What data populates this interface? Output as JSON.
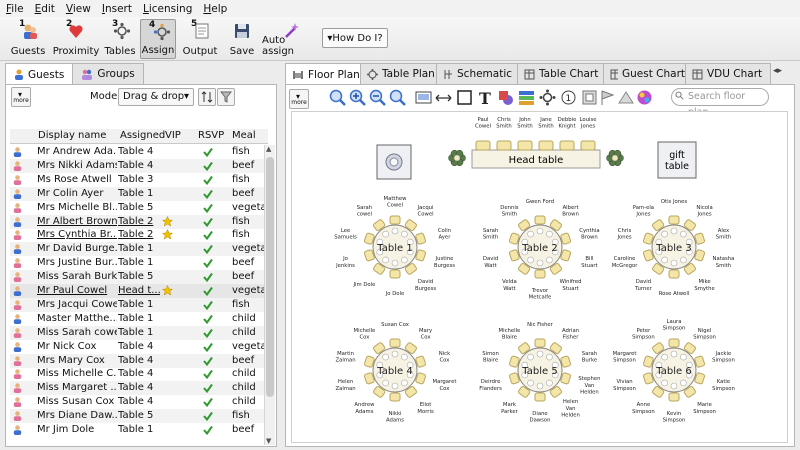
{
  "menu": [
    "File",
    "Edit",
    "View",
    "Insert",
    "Licensing",
    "Help"
  ],
  "toolbar": {
    "guests": "Guests",
    "proximity": "Proximity",
    "tables": "Tables",
    "assign": "Assign",
    "output": "Output",
    "save": "Save",
    "auto_assign": "Auto assign",
    "how_do_i": "▾How Do I?",
    "num1": "1",
    "num2": "2",
    "num3": "3",
    "num4": "4",
    "num5": "5"
  },
  "left_tabs": {
    "guests": "Guests",
    "groups": "Groups"
  },
  "more": "more",
  "mode_label": "Mode:",
  "mode_value": "Drag & drop",
  "columns": [
    "Display name",
    "Assigned",
    "VIP",
    "RSVP",
    "Meal"
  ],
  "guests": [
    {
      "name": "Mr Andrew Ada...",
      "table": "Table 4",
      "vip": false,
      "rsvp": true,
      "meal": "fish",
      "gender": "m"
    },
    {
      "name": "Mrs Nikki Adams",
      "table": "Table 4",
      "vip": false,
      "rsvp": true,
      "meal": "beef",
      "gender": "f"
    },
    {
      "name": "Ms Rose Atwell",
      "table": "Table 3",
      "vip": false,
      "rsvp": true,
      "meal": "fish",
      "gender": "f"
    },
    {
      "name": "Mr Colin Ayer",
      "table": "Table 1",
      "vip": false,
      "rsvp": true,
      "meal": "beef",
      "gender": "m"
    },
    {
      "name": "Mrs Michelle Bl...",
      "table": "Table 5",
      "vip": false,
      "rsvp": true,
      "meal": "vegetar...",
      "gender": "f"
    },
    {
      "name": "Mr Albert Brown",
      "table": "Table 2",
      "vip": true,
      "rsvp": true,
      "meal": "fish",
      "gender": "m",
      "underline": true
    },
    {
      "name": "Mrs Cynthia Br...",
      "table": "Table 2",
      "vip": true,
      "rsvp": true,
      "meal": "fish",
      "gender": "f",
      "underline": true
    },
    {
      "name": "Mr David Burge...",
      "table": "Table 1",
      "vip": false,
      "rsvp": true,
      "meal": "vegetar...",
      "gender": "m"
    },
    {
      "name": "Mrs Justine Bur...",
      "table": "Table 1",
      "vip": false,
      "rsvp": true,
      "meal": "beef",
      "gender": "f"
    },
    {
      "name": "Miss Sarah Burke",
      "table": "Table 5",
      "vip": false,
      "rsvp": true,
      "meal": "beef",
      "gender": "f"
    },
    {
      "name": "Mr Paul Cowel",
      "table": "Head t...",
      "vip": true,
      "rsvp": true,
      "meal": "vegetar...",
      "gender": "m",
      "underline": true
    },
    {
      "name": "Mrs Jacqui Cowel",
      "table": "Table 1",
      "vip": false,
      "rsvp": true,
      "meal": "fish",
      "gender": "f"
    },
    {
      "name": "Master Matthe...",
      "table": "Table 1",
      "vip": false,
      "rsvp": true,
      "meal": "child",
      "gender": "m"
    },
    {
      "name": "Miss Sarah cowel",
      "table": "Table 1",
      "vip": false,
      "rsvp": true,
      "meal": "child",
      "gender": "f"
    },
    {
      "name": "Mr Nick Cox",
      "table": "Table 4",
      "vip": false,
      "rsvp": true,
      "meal": "vegetar...",
      "gender": "m"
    },
    {
      "name": "Mrs Mary Cox",
      "table": "Table 4",
      "vip": false,
      "rsvp": true,
      "meal": "beef",
      "gender": "f"
    },
    {
      "name": "Miss Michelle C...",
      "table": "Table 4",
      "vip": false,
      "rsvp": true,
      "meal": "child",
      "gender": "f"
    },
    {
      "name": "Miss Margaret ...",
      "table": "Table 4",
      "vip": false,
      "rsvp": true,
      "meal": "child",
      "gender": "f"
    },
    {
      "name": "Miss Susan Cox",
      "table": "Table 4",
      "vip": false,
      "rsvp": true,
      "meal": "child",
      "gender": "f"
    },
    {
      "name": "Mrs Diane Daw...",
      "table": "Table 5",
      "vip": false,
      "rsvp": true,
      "meal": "fish",
      "gender": "f"
    },
    {
      "name": "Mr Jim Dole",
      "table": "Table 1",
      "vip": false,
      "rsvp": true,
      "meal": "beef",
      "gender": "m"
    }
  ],
  "right_tabs": [
    "Floor Plan",
    "Table Plan",
    "Schematic",
    "Table Chart",
    "Guest Chart",
    "VDU Chart"
  ],
  "search_placeholder": "Search floor plan",
  "floor": {
    "head_table": "Head table",
    "head_names": [
      [
        "Paul",
        "Cowel"
      ],
      [
        "Chris",
        "Smith"
      ],
      [
        "John",
        "Smith"
      ],
      [
        "Jane",
        "Smith"
      ],
      [
        "Debbie",
        "Knight"
      ],
      [
        "Louise",
        "Jones"
      ]
    ],
    "gift_table": [
      "gift",
      "table"
    ],
    "tables": [
      {
        "label": "Table 1",
        "names": [
          [
            "Matthew",
            "Cowel"
          ],
          [
            "Jacqui",
            "Cowel"
          ],
          [
            "Colin",
            "Ayer"
          ],
          [
            "Justine",
            "Burgess"
          ],
          [
            "David",
            "Burgess"
          ],
          [
            "Jo Dole"
          ],
          [
            "Jim Dole"
          ],
          [
            "Jo",
            "Jenkins"
          ],
          [
            "Lee",
            "Samuels"
          ],
          [
            "Sarah",
            "cowel"
          ]
        ]
      },
      {
        "label": "Table 2",
        "names": [
          [
            "Gwen Ford"
          ],
          [
            "Albert",
            "Brown"
          ],
          [
            "Cynthia",
            "Brown"
          ],
          [
            "Bill",
            "Stuart"
          ],
          [
            "Winifred",
            "Stuart"
          ],
          [
            "Trevor",
            "Metcalfe"
          ],
          [
            "Velda",
            "Watt"
          ],
          [
            "David",
            "Watt"
          ],
          [
            "Sarah",
            "Smith"
          ],
          [
            "Dennis",
            "Smith"
          ]
        ]
      },
      {
        "label": "Table 3",
        "names": [
          [
            "Otis Jones"
          ],
          [
            "Nicola",
            "Jones"
          ],
          [
            "Alex",
            "Smith"
          ],
          [
            "Natasha",
            "Smith"
          ],
          [
            "Mike",
            "Smythe"
          ],
          [
            "Rose Atwell"
          ],
          [
            "David",
            "Turner"
          ],
          [
            "Caroline",
            "McGregor"
          ],
          [
            "Chris",
            "Jones"
          ],
          [
            "Pam-ela",
            "Jones"
          ]
        ]
      },
      {
        "label": "Table 4",
        "names": [
          [
            "Susan Cox"
          ],
          [
            "Mary",
            "Cox"
          ],
          [
            "Nick",
            "Cox"
          ],
          [
            "Margaret",
            "Cox"
          ],
          [
            "Eliot",
            "Morris"
          ],
          [
            "Nikki",
            "Adams"
          ],
          [
            "Andrew",
            "Adams"
          ],
          [
            "Helen",
            "Zalman"
          ],
          [
            "Martin",
            "Zalman"
          ],
          [
            "Michelle",
            "Cox"
          ]
        ]
      },
      {
        "label": "Table 5",
        "names": [
          [
            "Nic Fisher"
          ],
          [
            "Adrian",
            "Fisher"
          ],
          [
            "Sarah",
            "Burke"
          ],
          [
            "Stephen",
            "Van",
            "Helden"
          ],
          [
            "Helen",
            "Van",
            "Helden"
          ],
          [
            "Diane",
            "Dawson"
          ],
          [
            "Mark",
            "Parker"
          ],
          [
            "Deirdre",
            "Flanders"
          ],
          [
            "Simon",
            "Blaire"
          ],
          [
            "Michelle",
            "Blaire"
          ]
        ]
      },
      {
        "label": "Table 6",
        "names": [
          [
            "Laura",
            "Simpson"
          ],
          [
            "Nigel",
            "Simpson"
          ],
          [
            "Jackie",
            "Simpson"
          ],
          [
            "Katie",
            "Simpson"
          ],
          [
            "Marie",
            "Simpson"
          ],
          [
            "Kevin",
            "Simpson"
          ],
          [
            "Anne",
            "Simpson"
          ],
          [
            "Vivian",
            "Simpson"
          ],
          [
            "Margaret",
            "Simpson"
          ],
          [
            "Peter",
            "Simpson"
          ]
        ]
      }
    ]
  },
  "colors": {
    "check": "#2e9a2e",
    "star": "#f2c200",
    "male": "#3c6fd0",
    "female": "#e0709a",
    "chair": "#f4e6a8",
    "table_fill": "#f7f3e4"
  }
}
